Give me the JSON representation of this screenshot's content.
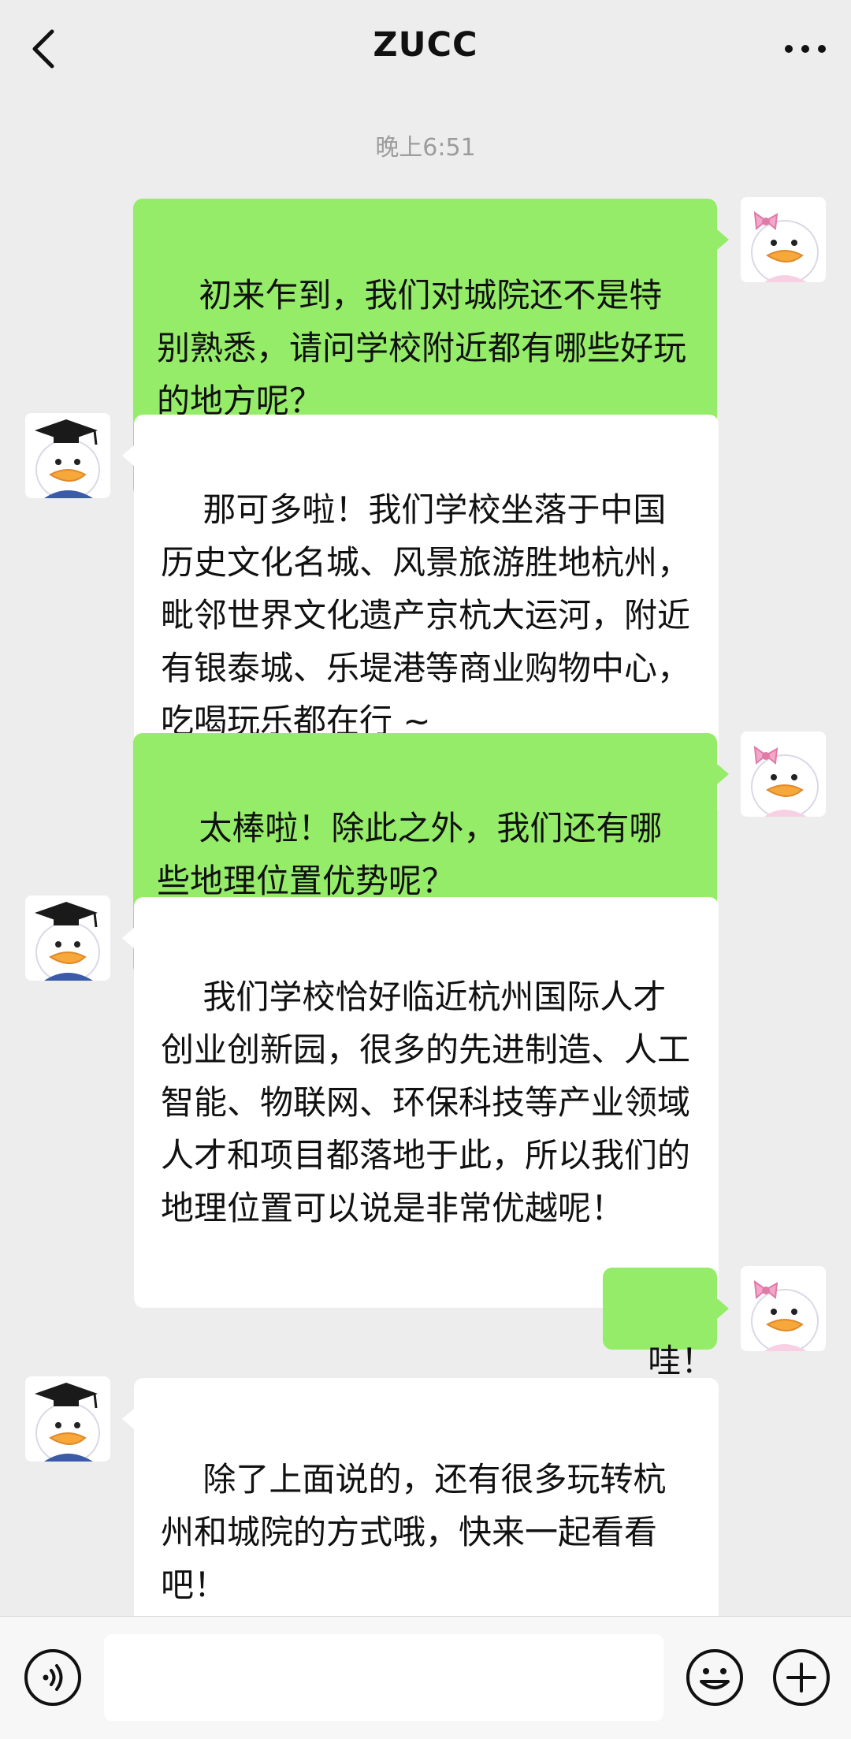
{
  "header": {
    "title": "ZUCC"
  },
  "timestamp": "晚上6:51",
  "messages": [
    {
      "side": "out",
      "text": "初来乍到，我们对城院还不是特别熟悉，请问学校附近都有哪些好玩的地方呢？",
      "avatar": "girl-duck-avatar"
    },
    {
      "side": "in",
      "text": "那可多啦！我们学校坐落于中国历史文化名城、风景旅游胜地杭州，毗邻世界文化遗产京杭大运河，附近有银泰城、乐堤港等商业购物中心，吃喝玩乐都在行 ~",
      "avatar": "graduate-duck-avatar"
    },
    {
      "side": "out",
      "text": "太棒啦！除此之外，我们还有哪些地理位置优势呢？",
      "avatar": "girl-duck-avatar"
    },
    {
      "side": "in",
      "text": "我们学校恰好临近杭州国际人才创业创新园，很多的先进制造、人工智能、物联网、环保科技等产业领域人才和项目都落地于此，所以我们的地理位置可以说是非常优越呢！",
      "avatar": "graduate-duck-avatar"
    },
    {
      "side": "out",
      "text": "哇！",
      "avatar": "girl-duck-avatar"
    },
    {
      "side": "in",
      "text": "除了上面说的，还有很多玩转杭州和城院的方式哦，快来一起看看吧！",
      "avatar": "graduate-duck-avatar"
    }
  ],
  "input": {
    "value": ""
  },
  "colors": {
    "outgoing_bubble": "#95ec69",
    "incoming_bubble": "#ffffff",
    "background": "#ededed"
  },
  "icons": {
    "back": "chevron-left-icon",
    "more": "more-dots-icon",
    "voice": "voice-icon",
    "emoji": "emoji-icon",
    "plus": "plus-icon"
  }
}
